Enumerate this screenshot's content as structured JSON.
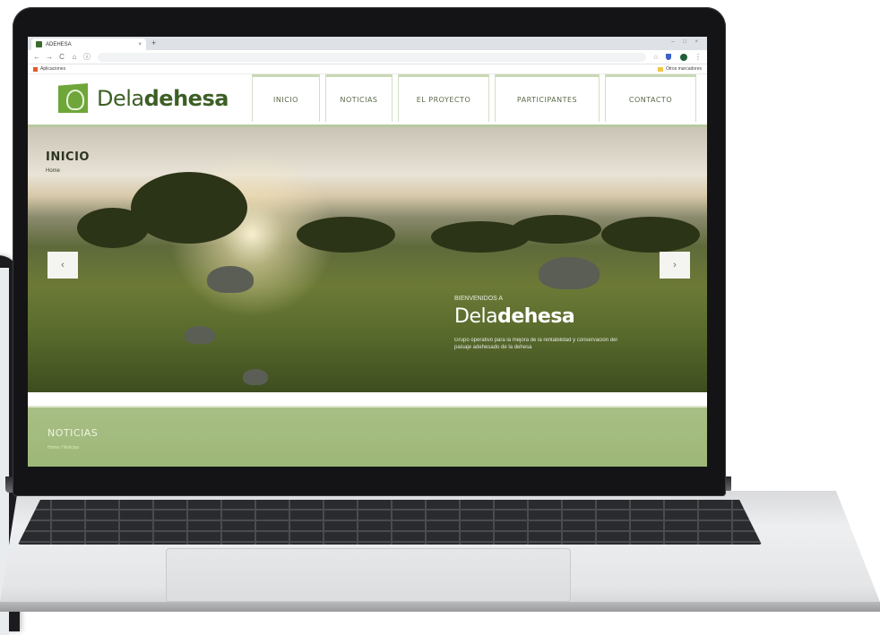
{
  "browser": {
    "tab_title": "ADEHESA",
    "tab_close": "×",
    "new_tab": "+",
    "window_controls": "– □ ×",
    "nav": {
      "back": "←",
      "forward": "→",
      "reload": "C",
      "home": "⌂",
      "info": "ⓘ"
    },
    "star": "☆",
    "menu": "⋮",
    "bookmark_apps": "Aplicaciones",
    "bookmark_other": "Otros marcadores"
  },
  "site": {
    "logo_prefix": "Dela",
    "logo_bold": "dehesa",
    "nav": [
      {
        "label": "INICIO"
      },
      {
        "label": "NOTICIAS"
      },
      {
        "label": "EL PROYECTO"
      },
      {
        "label": "PARTICIPANTES"
      },
      {
        "label": "CONTACTO"
      }
    ],
    "hero": {
      "title": "INICIO",
      "breadcrumb": "Home",
      "prev": "‹",
      "next": "›",
      "welcome": "BIENVENIDOS A",
      "brand_prefix": "Dela",
      "brand_bold": "dehesa",
      "description": "Grupo operativo para la mejora de la rentabilidad y conservación del paisaje adehesado de la dehesa"
    },
    "news": {
      "title": "NOTICIAS",
      "crumb_home": "Home",
      "crumb_sep": " / ",
      "crumb_current": "Noticias"
    }
  },
  "colors": {
    "brand_green": "#6fa63a",
    "logo_text": "#3d5f25",
    "news_band": "#a8bf85"
  }
}
